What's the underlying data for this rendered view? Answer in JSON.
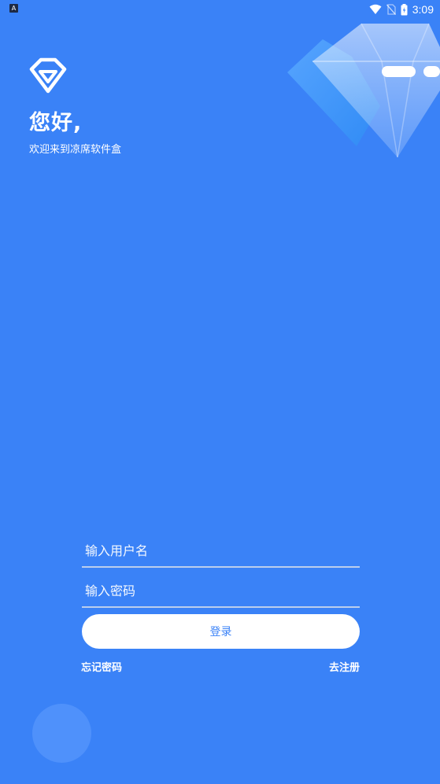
{
  "status_bar": {
    "app_icon_label": "A",
    "time": "3:09"
  },
  "header": {
    "greeting": "您好,",
    "welcome": "欢迎来到凉席软件盒"
  },
  "form": {
    "username_placeholder": "输入用户名",
    "password_placeholder": "输入密码",
    "login_label": "登录",
    "forgot_password_label": "忘记密码",
    "register_label": "去注册"
  },
  "colors": {
    "background": "#3a82f7",
    "button_text": "#3a82f7",
    "field_underline": "#d2dceb",
    "deco_circle": "#4f91fb"
  }
}
